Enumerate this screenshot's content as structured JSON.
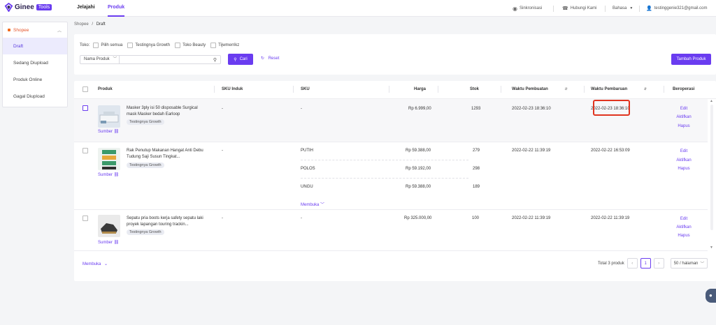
{
  "brand": {
    "name": "Ginee",
    "tag": "Tools"
  },
  "topnav": {
    "jelajahi": "Jelajahi",
    "produk": "Produk"
  },
  "topright": {
    "sinkronisasi": "Sinkronisasi",
    "hubungi": "Hubungi Kami",
    "bahasa": "Bahasa",
    "email": "testinggenie321@gmail.com"
  },
  "sidebar": {
    "shop": "Shopee",
    "items": [
      {
        "label": "Draft"
      },
      {
        "label": "Sedang Diupload"
      },
      {
        "label": "Produk Online"
      },
      {
        "label": "Gagal Diupload"
      }
    ]
  },
  "breadcrumb": {
    "root": "Shopee",
    "sep": "/",
    "current": "Draft"
  },
  "filter": {
    "toko_label": "Toko:",
    "shops": [
      "Pilih semua",
      "Testingnya Growth",
      "Toko Beauty",
      "Tijwmerrikz"
    ],
    "search_field": "Nama Produk",
    "search_button": "Cari",
    "reset_button": "Reset",
    "add_button": "Tambah Produk"
  },
  "table": {
    "headers": {
      "produk": "Produk",
      "sku_induk": "SKU Induk",
      "sku": "SKU",
      "harga": "Harga",
      "stok": "Stok",
      "waktu_pembuatan": "Waktu Pembuatan",
      "waktu_pembaruan": "Waktu Pembaruan",
      "beroperasi": "Beroperasi"
    },
    "rows": [
      {
        "name": "Masker 3ply isi 50 disposable Surgical mask Masker bedah Earloop",
        "shop": "Testingnya Growth",
        "source": "Sumber",
        "sku_induk": "-",
        "sku": "-",
        "harga": "Rp 6.999,00",
        "stok": "1293",
        "created": "2022-02-23 18:36:10",
        "updated": "2022-02-23 18:36:10",
        "ops": [
          "Edit",
          "Aktifkan",
          "Hapus"
        ]
      },
      {
        "name": "Rak Penutup Makanan Hangat Anti Debu Tudung Saji Susun Tingkat...",
        "shop": "Testingnya Growth",
        "source": "Sumber",
        "sku_induk": "-",
        "variants": [
          {
            "sku": "PUTIH",
            "harga": "Rp 59.388,00",
            "stok": "279"
          },
          {
            "sku": "POLOS",
            "harga": "Rp 59.192,00",
            "stok": "298"
          },
          {
            "sku": "UNGU",
            "harga": "Rp 59.388,00",
            "stok": "189"
          }
        ],
        "expand": "Membuka",
        "created": "2022-02-22 11:39:19",
        "updated": "2022-02-22 16:53:09",
        "ops": [
          "Edit",
          "Aktifkan",
          "Hapus"
        ]
      },
      {
        "name": "Sepatu pria boots kerja safety sepatu laki proyek lapangan touring trackin...",
        "shop": "Testingnya Growth",
        "source": "Sumber",
        "sku_induk": "-",
        "sku": "-",
        "harga": "Rp 325.000,00",
        "stok": "100",
        "created": "2022-02-22 11:39:19",
        "updated": "2022-02-22 11:39:19",
        "ops": [
          "Edit",
          "Aktifkan",
          "Hapus"
        ]
      }
    ]
  },
  "footer": {
    "expand": "Membuka",
    "total": "Total 3 produk",
    "page": "1",
    "per_page": "50 / halaman"
  },
  "colors": {
    "accent": "#6a3cf0",
    "highlight": "#e0341f"
  }
}
